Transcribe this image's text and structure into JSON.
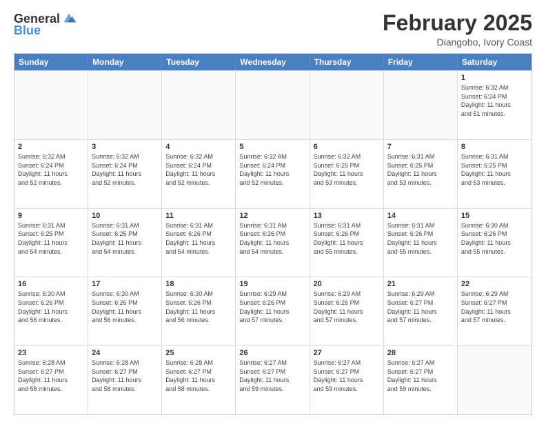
{
  "header": {
    "logo": {
      "general": "General",
      "blue": "Blue"
    },
    "title": "February 2025",
    "subtitle": "Diangobo, Ivory Coast"
  },
  "calendar": {
    "days_of_week": [
      "Sunday",
      "Monday",
      "Tuesday",
      "Wednesday",
      "Thursday",
      "Friday",
      "Saturday"
    ],
    "weeks": [
      [
        {
          "day": "",
          "empty": true
        },
        {
          "day": "",
          "empty": true
        },
        {
          "day": "",
          "empty": true
        },
        {
          "day": "",
          "empty": true
        },
        {
          "day": "",
          "empty": true
        },
        {
          "day": "",
          "empty": true
        },
        {
          "day": "1",
          "info": "Sunrise: 6:32 AM\nSunset: 6:24 PM\nDaylight: 11 hours\nand 51 minutes."
        }
      ],
      [
        {
          "day": "2",
          "info": "Sunrise: 6:32 AM\nSunset: 6:24 PM\nDaylight: 11 hours\nand 52 minutes."
        },
        {
          "day": "3",
          "info": "Sunrise: 6:32 AM\nSunset: 6:24 PM\nDaylight: 11 hours\nand 52 minutes."
        },
        {
          "day": "4",
          "info": "Sunrise: 6:32 AM\nSunset: 6:24 PM\nDaylight: 11 hours\nand 52 minutes."
        },
        {
          "day": "5",
          "info": "Sunrise: 6:32 AM\nSunset: 6:24 PM\nDaylight: 11 hours\nand 52 minutes."
        },
        {
          "day": "6",
          "info": "Sunrise: 6:32 AM\nSunset: 6:25 PM\nDaylight: 11 hours\nand 53 minutes."
        },
        {
          "day": "7",
          "info": "Sunrise: 6:31 AM\nSunset: 6:25 PM\nDaylight: 11 hours\nand 53 minutes."
        },
        {
          "day": "8",
          "info": "Sunrise: 6:31 AM\nSunset: 6:25 PM\nDaylight: 11 hours\nand 53 minutes."
        }
      ],
      [
        {
          "day": "9",
          "info": "Sunrise: 6:31 AM\nSunset: 6:25 PM\nDaylight: 11 hours\nand 54 minutes."
        },
        {
          "day": "10",
          "info": "Sunrise: 6:31 AM\nSunset: 6:25 PM\nDaylight: 11 hours\nand 54 minutes."
        },
        {
          "day": "11",
          "info": "Sunrise: 6:31 AM\nSunset: 6:26 PM\nDaylight: 11 hours\nand 54 minutes."
        },
        {
          "day": "12",
          "info": "Sunrise: 6:31 AM\nSunset: 6:26 PM\nDaylight: 11 hours\nand 54 minutes."
        },
        {
          "day": "13",
          "info": "Sunrise: 6:31 AM\nSunset: 6:26 PM\nDaylight: 11 hours\nand 55 minutes."
        },
        {
          "day": "14",
          "info": "Sunrise: 6:31 AM\nSunset: 6:26 PM\nDaylight: 11 hours\nand 55 minutes."
        },
        {
          "day": "15",
          "info": "Sunrise: 6:30 AM\nSunset: 6:26 PM\nDaylight: 11 hours\nand 55 minutes."
        }
      ],
      [
        {
          "day": "16",
          "info": "Sunrise: 6:30 AM\nSunset: 6:26 PM\nDaylight: 11 hours\nand 56 minutes."
        },
        {
          "day": "17",
          "info": "Sunrise: 6:30 AM\nSunset: 6:26 PM\nDaylight: 11 hours\nand 56 minutes."
        },
        {
          "day": "18",
          "info": "Sunrise: 6:30 AM\nSunset: 6:26 PM\nDaylight: 11 hours\nand 56 minutes."
        },
        {
          "day": "19",
          "info": "Sunrise: 6:29 AM\nSunset: 6:26 PM\nDaylight: 11 hours\nand 57 minutes."
        },
        {
          "day": "20",
          "info": "Sunrise: 6:29 AM\nSunset: 6:26 PM\nDaylight: 11 hours\nand 57 minutes."
        },
        {
          "day": "21",
          "info": "Sunrise: 6:29 AM\nSunset: 6:27 PM\nDaylight: 11 hours\nand 57 minutes."
        },
        {
          "day": "22",
          "info": "Sunrise: 6:29 AM\nSunset: 6:27 PM\nDaylight: 11 hours\nand 57 minutes."
        }
      ],
      [
        {
          "day": "23",
          "info": "Sunrise: 6:28 AM\nSunset: 6:27 PM\nDaylight: 11 hours\nand 58 minutes."
        },
        {
          "day": "24",
          "info": "Sunrise: 6:28 AM\nSunset: 6:27 PM\nDaylight: 11 hours\nand 58 minutes."
        },
        {
          "day": "25",
          "info": "Sunrise: 6:28 AM\nSunset: 6:27 PM\nDaylight: 11 hours\nand 58 minutes."
        },
        {
          "day": "26",
          "info": "Sunrise: 6:27 AM\nSunset: 6:27 PM\nDaylight: 11 hours\nand 59 minutes."
        },
        {
          "day": "27",
          "info": "Sunrise: 6:27 AM\nSunset: 6:27 PM\nDaylight: 11 hours\nand 59 minutes."
        },
        {
          "day": "28",
          "info": "Sunrise: 6:27 AM\nSunset: 6:27 PM\nDaylight: 11 hours\nand 59 minutes."
        },
        {
          "day": "",
          "empty": true
        }
      ]
    ]
  }
}
